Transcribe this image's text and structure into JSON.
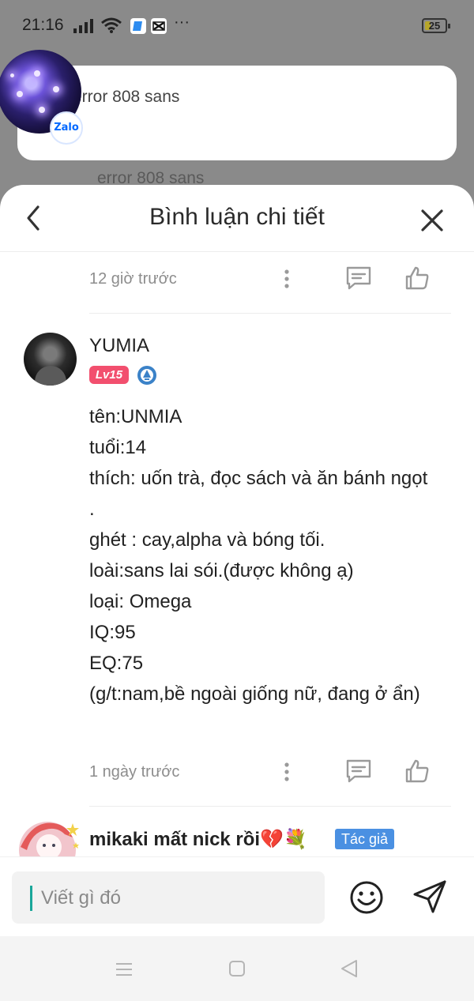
{
  "status_bar": {
    "time": "21:16",
    "more": "···",
    "battery": "25"
  },
  "background": {
    "faint_text": "error 808 sans"
  },
  "notification": {
    "text": "error 808 sans",
    "app_badge": "Zalo"
  },
  "sheet": {
    "title": "Bình luận chi tiết"
  },
  "previous_comment": {
    "time": "12 giờ trước"
  },
  "comment": {
    "author": "YUMIA",
    "level": "Lv15",
    "lines": [
      "tên:UNMIA",
      "tuổi:14",
      "thích: uốn trà, đọc sách và ăn bánh ngọt .",
      "ghét : cay,alpha và bóng tối.",
      "loài:sans lai sói.(được không ạ)",
      "loại: Omega",
      "IQ:95",
      "EQ:75",
      "(g/t:nam,bề ngoài giống nữ, đang ở ẩn)"
    ],
    "time": "1 ngày trước"
  },
  "next_comment": {
    "author": "mikaki mất nick rồi💔💐",
    "badge": "Tác giả"
  },
  "input": {
    "placeholder": "Viết gì đó"
  },
  "colors": {
    "level_badge": "#f24f6e",
    "author_badge": "#4a90e2",
    "caret": "#1aa79a",
    "zalo": "#0068ff"
  }
}
